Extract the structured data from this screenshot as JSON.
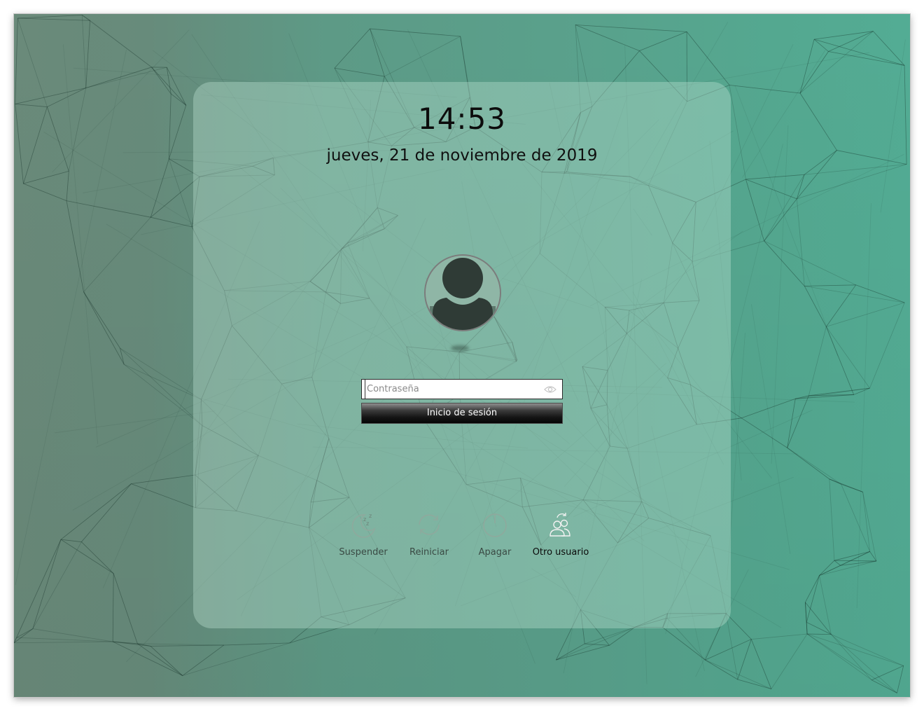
{
  "lock_screen": {
    "clock": "14:53",
    "date": "jueves, 21 de noviembre de 2019",
    "avatar_icon": "user-avatar-icon",
    "password": {
      "placeholder": "Contraseña",
      "value": "",
      "reveal_icon": "eye-icon"
    },
    "login_label": "Inicio de sesión",
    "actions": [
      {
        "label": "Suspender",
        "icon": "sleep-icon"
      },
      {
        "label": "Reiniciar",
        "icon": "restart-icon"
      },
      {
        "label": "Apagar",
        "icon": "power-icon"
      },
      {
        "label": "Otro usuario",
        "icon": "switch-user-icon"
      }
    ]
  }
}
